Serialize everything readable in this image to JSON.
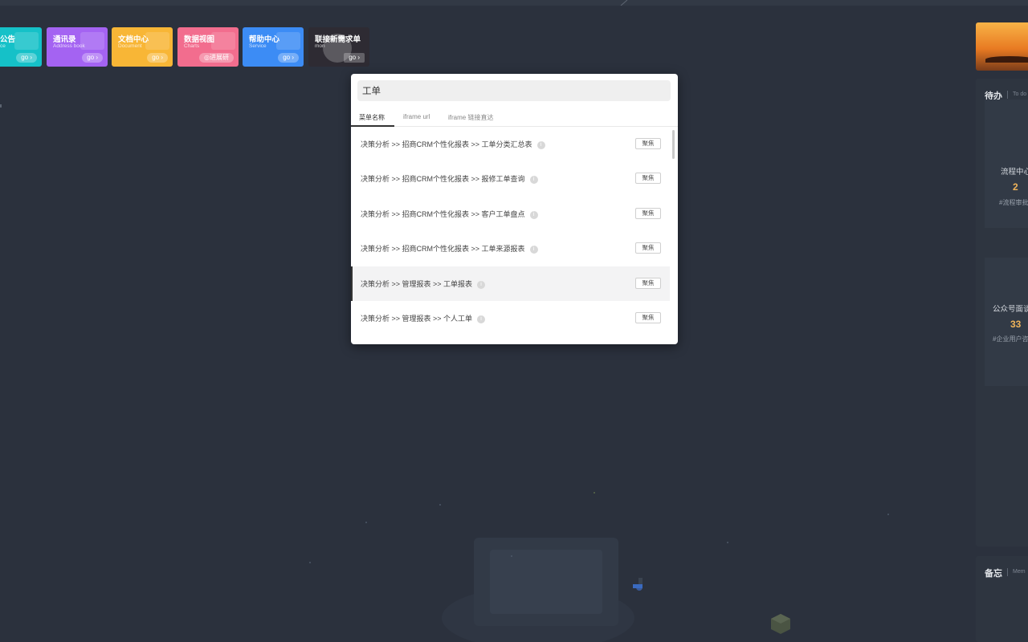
{
  "cards": [
    {
      "title": "公告",
      "subtitle": "ce",
      "go": "go ›",
      "color": "#15c1c8"
    },
    {
      "title": "通讯录",
      "subtitle": "Address book",
      "go": "go ›",
      "color": "#a463f2"
    },
    {
      "title": "文档中心",
      "subtitle": "Document",
      "go": "go ›",
      "color": "#f8b636"
    },
    {
      "title": "数据视图",
      "subtitle": "Charts",
      "go": "◎进展研",
      "color": "#f26d8e"
    },
    {
      "title": "帮助中心",
      "subtitle": "Service",
      "go": "go ›",
      "color": "#3c8cf5"
    },
    {
      "title": "联接新需求单",
      "subtitle": "mon",
      "go": "go ›",
      "color": "#2e2b33"
    }
  ],
  "modal": {
    "search_value": "工单",
    "tabs": [
      "菜单名称",
      "iframe url",
      "iframe 链接直达"
    ],
    "rows": [
      {
        "path": "决策分析 >> 招商CRM个性化报表 >> 工单分类汇总表",
        "button": "聚焦"
      },
      {
        "path": "决策分析 >> 招商CRM个性化报表 >> 报修工单查询",
        "button": "聚焦"
      },
      {
        "path": "决策分析 >> 招商CRM个性化报表 >> 客户工单盘点",
        "button": "聚焦"
      },
      {
        "path": "决策分析 >> 招商CRM个性化报表 >> 工单来源报表",
        "button": "聚焦"
      },
      {
        "path": "决策分析 >> 管理报表 >> 工单报表",
        "button": "聚焦"
      },
      {
        "path": "决策分析 >> 管理报表 >> 个人工单",
        "button": "聚焦"
      }
    ],
    "info_icon": "i"
  },
  "right_panel": {
    "todo_title": "待办",
    "todo_subtitle": "To do",
    "tiles": [
      {
        "name": "流程中心",
        "count": "2",
        "note": "#流程审批"
      },
      {
        "name": "公众号面谈",
        "count": "33",
        "note": "#企业用户咨"
      }
    ],
    "memo_title": "备忘",
    "memo_subtitle": "Mem"
  }
}
